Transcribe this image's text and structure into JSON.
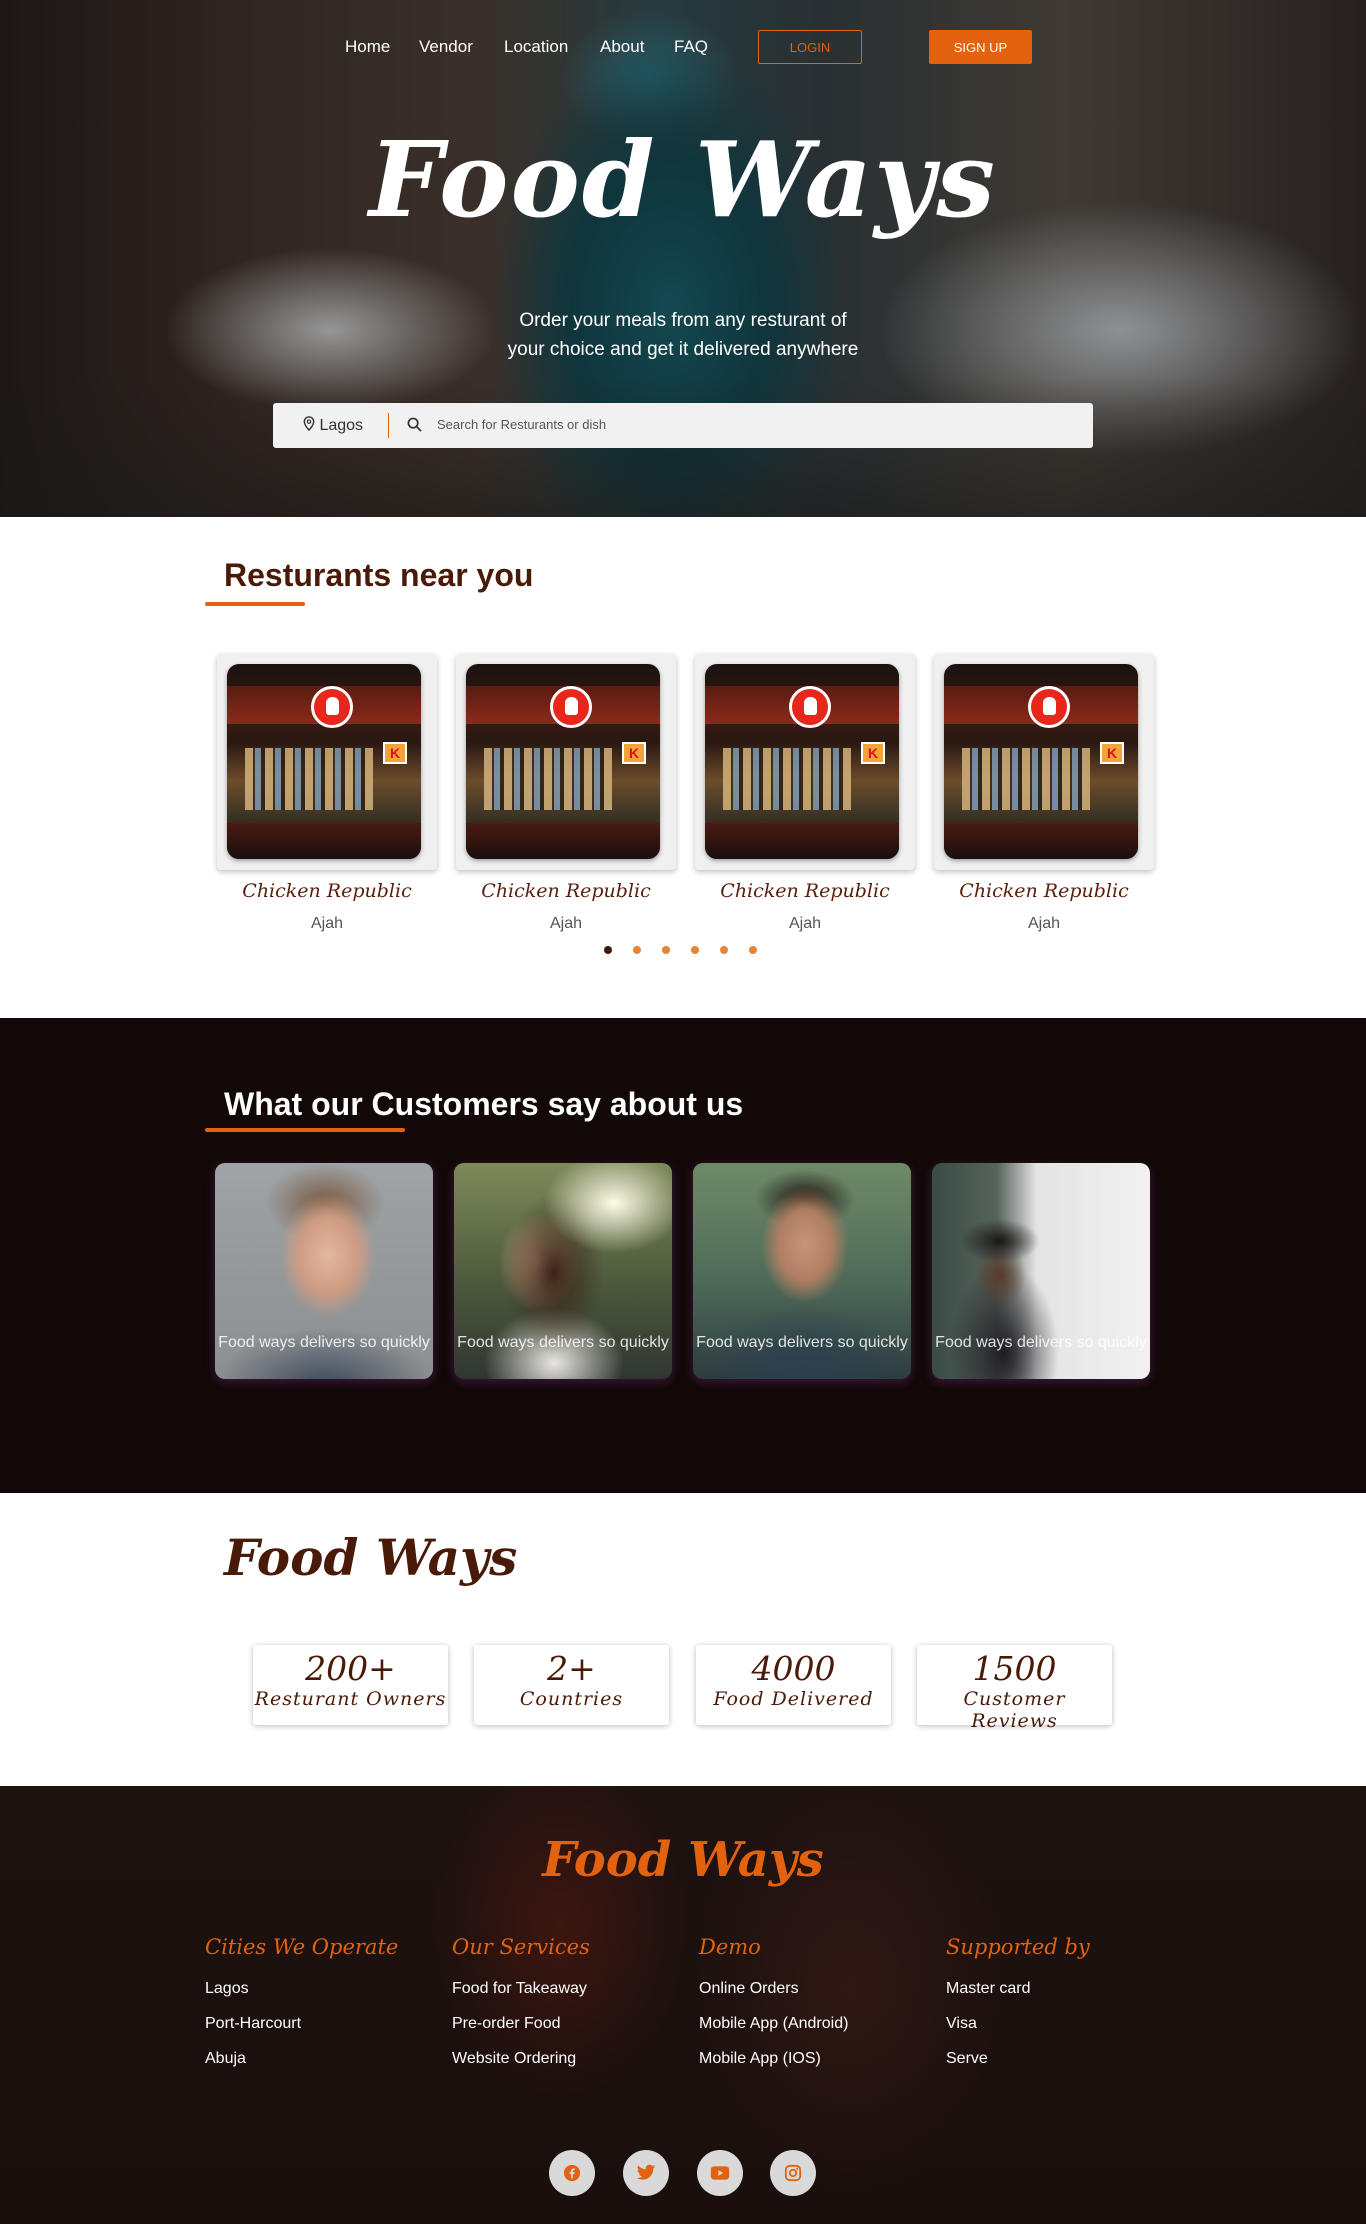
{
  "nav": {
    "links": [
      "Home",
      "Vendor",
      "Location",
      "About",
      "FAQ"
    ],
    "login": "LOGIN",
    "signup": "SIGN UP"
  },
  "hero": {
    "title": "Food Ways",
    "subtitle_line1": "Order your meals from any resturant of",
    "subtitle_line2": "your choice and get it delivered anywhere",
    "search": {
      "location": "Lagos",
      "placeholder": "Search for Resturants or dish"
    }
  },
  "restaurants": {
    "title": "Resturants near you",
    "items": [
      {
        "name": "Chicken Republic",
        "location": "Ajah"
      },
      {
        "name": "Chicken Republic",
        "location": "Ajah"
      },
      {
        "name": "Chicken Republic",
        "location": "Ajah"
      },
      {
        "name": "Chicken Republic",
        "location": "Ajah"
      }
    ],
    "carousel_pages": 6,
    "active_page": 1
  },
  "testimonials": {
    "title": "What our Customers say about us",
    "items": [
      {
        "text": "Food ways delivers so quickly"
      },
      {
        "text": "Food ways delivers so quickly"
      },
      {
        "text": "Food ways delivers so quickly"
      },
      {
        "text": "Food ways delivers so quickly"
      }
    ]
  },
  "stats": {
    "brand": "Food Ways",
    "items": [
      {
        "value": "200+",
        "label": "Resturant Owners"
      },
      {
        "value": "2+",
        "label": "Countries"
      },
      {
        "value": "4000",
        "label": "Food Delivered"
      },
      {
        "value": "1500",
        "label": "Customer Reviews"
      }
    ]
  },
  "footer": {
    "brand": "Food Ways",
    "columns": [
      {
        "heading": "Cities We Operate",
        "items": [
          "Lagos",
          "Port-Harcourt",
          "Abuja"
        ]
      },
      {
        "heading": "Our Services",
        "items": [
          "Food for Takeaway",
          "Pre-order Food",
          "Website Ordering"
        ]
      },
      {
        "heading": "Demo",
        "items": [
          "Online Orders",
          "Mobile App (Android)",
          "Mobile App (IOS)"
        ]
      },
      {
        "heading": "Supported by",
        "items": [
          "Master card",
          "Visa",
          "Serve"
        ]
      }
    ],
    "social": [
      "facebook-icon",
      "twitter-icon",
      "youtube-icon",
      "instagram-icon"
    ]
  },
  "colors": {
    "accent": "#e2620f",
    "dark_brown": "#4a1a08",
    "dark_band": "#120807"
  }
}
